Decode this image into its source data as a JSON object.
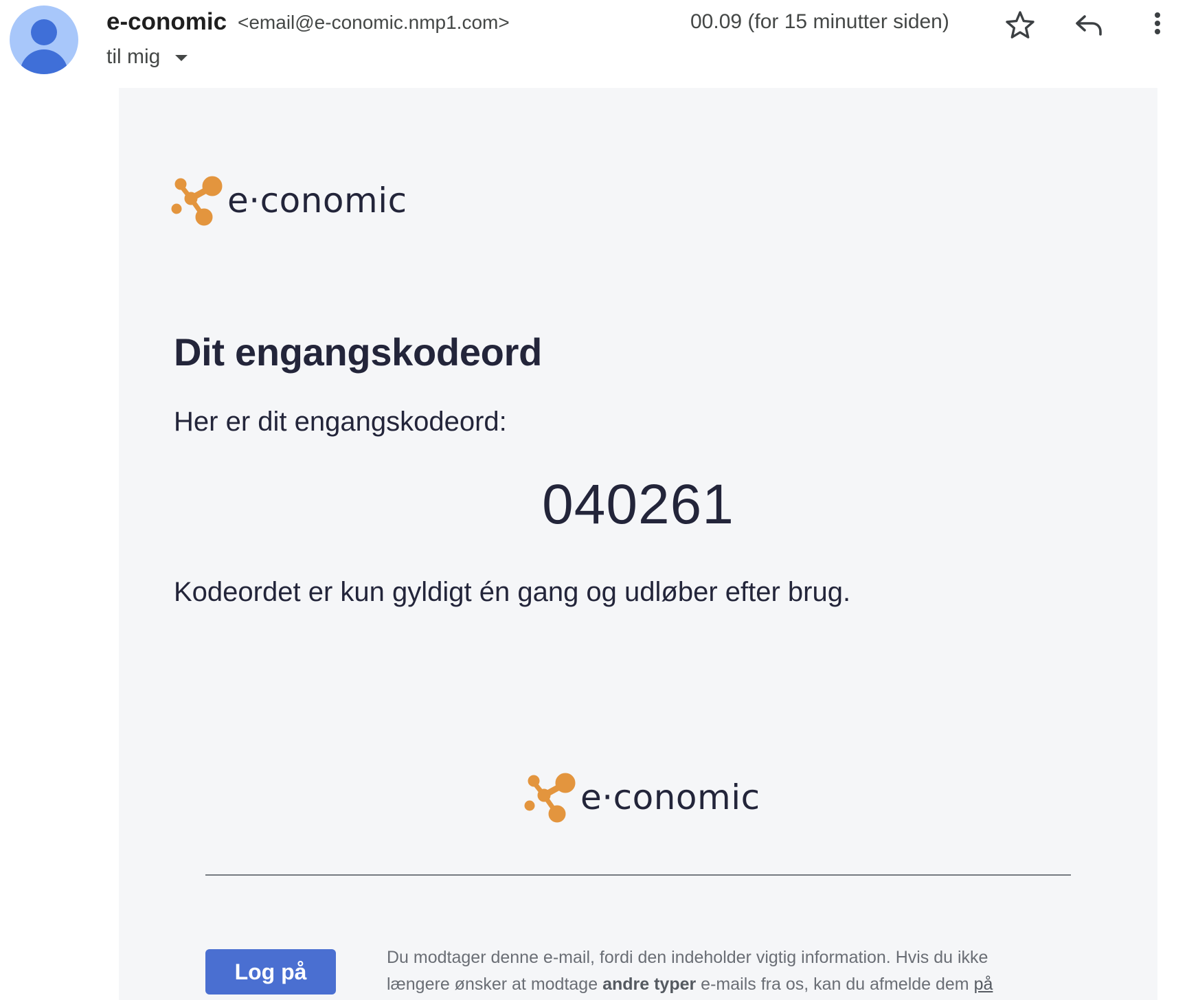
{
  "header": {
    "sender_name": "e-conomic",
    "sender_email": "<email@e-conomic.nmp1.com>",
    "recipient": "til mig",
    "timestamp": "00.09 (for 15 minutter siden)",
    "icons": [
      "avatar",
      "star-icon",
      "reply-icon",
      "more-vert-icon",
      "chevron-down-icon"
    ]
  },
  "email": {
    "logo_text": "e·conomic",
    "title": "Dit engangskodeord",
    "intro": "Her er dit engangskodeord:",
    "code": "040261",
    "note": "Kodeordet er kun gyldigt én gang og udløber efter brug.",
    "footer_logo_text": "e·conomic",
    "login_button": "Log på",
    "footer": {
      "part1": "Du modtager denne e-mail, fordi den indeholder vigtig information. Hvis du ikke længere ønsker at modtage ",
      "bold": "andre typer",
      "part2": " e-mails fra os, kan du afmelde dem ",
      "link": "på"
    }
  },
  "colors": {
    "brand_orange": "#e3953e",
    "text_dark": "#23253a",
    "button_blue": "#4a6fd1",
    "email_background": "#f5f6f8"
  }
}
